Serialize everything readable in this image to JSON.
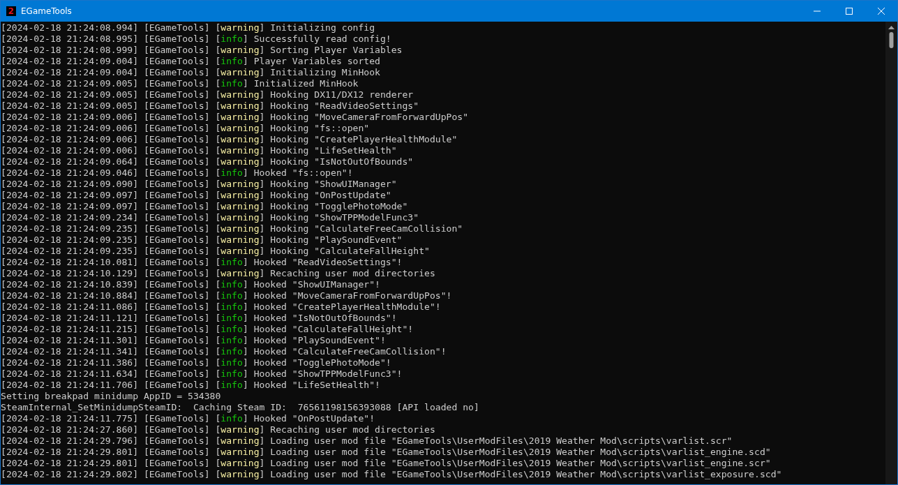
{
  "window": {
    "title": "EGameTools",
    "icon_text": "2"
  },
  "lines": [
    {
      "kind": "warning",
      "prefix": "[2024-02-18 21:24:08.994] [EGameTools] [",
      "level": "warning",
      "message": "] Initializing config"
    },
    {
      "kind": "info",
      "prefix": "[2024-02-18 21:24:08.995] [EGameTools] [",
      "level": "info",
      "message": "] Successfully read config!"
    },
    {
      "kind": "warning",
      "prefix": "[2024-02-18 21:24:08.999] [EGameTools] [",
      "level": "warning",
      "message": "] Sorting Player Variables"
    },
    {
      "kind": "info",
      "prefix": "[2024-02-18 21:24:09.004] [EGameTools] [",
      "level": "info",
      "message": "] Player Variables sorted"
    },
    {
      "kind": "warning",
      "prefix": "[2024-02-18 21:24:09.004] [EGameTools] [",
      "level": "warning",
      "message": "] Initializing MinHook"
    },
    {
      "kind": "info",
      "prefix": "[2024-02-18 21:24:09.005] [EGameTools] [",
      "level": "info",
      "message": "] Initialized MinHook"
    },
    {
      "kind": "warning",
      "prefix": "[2024-02-18 21:24:09.005] [EGameTools] [",
      "level": "warning",
      "message": "] Hooking DX11/DX12 renderer"
    },
    {
      "kind": "warning",
      "prefix": "[2024-02-18 21:24:09.005] [EGameTools] [",
      "level": "warning",
      "message": "] Hooking \"ReadVideoSettings\""
    },
    {
      "kind": "warning",
      "prefix": "[2024-02-18 21:24:09.006] [EGameTools] [",
      "level": "warning",
      "message": "] Hooking \"MoveCameraFromForwardUpPos\""
    },
    {
      "kind": "warning",
      "prefix": "[2024-02-18 21:24:09.006] [EGameTools] [",
      "level": "warning",
      "message": "] Hooking \"fs::open\""
    },
    {
      "kind": "warning",
      "prefix": "[2024-02-18 21:24:09.006] [EGameTools] [",
      "level": "warning",
      "message": "] Hooking \"CreatePlayerHealthModule\""
    },
    {
      "kind": "warning",
      "prefix": "[2024-02-18 21:24:09.006] [EGameTools] [",
      "level": "warning",
      "message": "] Hooking \"LifeSetHealth\""
    },
    {
      "kind": "warning",
      "prefix": "[2024-02-18 21:24:09.064] [EGameTools] [",
      "level": "warning",
      "message": "] Hooking \"IsNotOutOfBounds\""
    },
    {
      "kind": "info",
      "prefix": "[2024-02-18 21:24:09.046] [EGameTools] [",
      "level": "info",
      "message": "] Hooked \"fs::open\"!"
    },
    {
      "kind": "warning",
      "prefix": "[2024-02-18 21:24:09.090] [EGameTools] [",
      "level": "warning",
      "message": "] Hooking \"ShowUIManager\""
    },
    {
      "kind": "warning",
      "prefix": "[2024-02-18 21:24:09.097] [EGameTools] [",
      "level": "warning",
      "message": "] Hooking \"OnPostUpdate\""
    },
    {
      "kind": "warning",
      "prefix": "[2024-02-18 21:24:09.097] [EGameTools] [",
      "level": "warning",
      "message": "] Hooking \"TogglePhotoMode\""
    },
    {
      "kind": "warning",
      "prefix": "[2024-02-18 21:24:09.234] [EGameTools] [",
      "level": "warning",
      "message": "] Hooking \"ShowTPPModelFunc3\""
    },
    {
      "kind": "warning",
      "prefix": "[2024-02-18 21:24:09.235] [EGameTools] [",
      "level": "warning",
      "message": "] Hooking \"CalculateFreeCamCollision\""
    },
    {
      "kind": "warning",
      "prefix": "[2024-02-18 21:24:09.235] [EGameTools] [",
      "level": "warning",
      "message": "] Hooking \"PlaySoundEvent\""
    },
    {
      "kind": "warning",
      "prefix": "[2024-02-18 21:24:09.235] [EGameTools] [",
      "level": "warning",
      "message": "] Hooking \"CalculateFallHeight\""
    },
    {
      "kind": "info",
      "prefix": "[2024-02-18 21:24:10.081] [EGameTools] [",
      "level": "info",
      "message": "] Hooked \"ReadVideoSettings\"!"
    },
    {
      "kind": "warning",
      "prefix": "[2024-02-18 21:24:10.129] [EGameTools] [",
      "level": "warning",
      "message": "] Recaching user mod directories"
    },
    {
      "kind": "info",
      "prefix": "[2024-02-18 21:24:10.839] [EGameTools] [",
      "level": "info",
      "message": "] Hooked \"ShowUIManager\"!"
    },
    {
      "kind": "info",
      "prefix": "[2024-02-18 21:24:10.884] [EGameTools] [",
      "level": "info",
      "message": "] Hooked \"MoveCameraFromForwardUpPos\"!"
    },
    {
      "kind": "info",
      "prefix": "[2024-02-18 21:24:11.086] [EGameTools] [",
      "level": "info",
      "message": "] Hooked \"CreatePlayerHealthModule\"!"
    },
    {
      "kind": "info",
      "prefix": "[2024-02-18 21:24:11.121] [EGameTools] [",
      "level": "info",
      "message": "] Hooked \"IsNotOutOfBounds\"!"
    },
    {
      "kind": "info",
      "prefix": "[2024-02-18 21:24:11.215] [EGameTools] [",
      "level": "info",
      "message": "] Hooked \"CalculateFallHeight\"!"
    },
    {
      "kind": "info",
      "prefix": "[2024-02-18 21:24:11.301] [EGameTools] [",
      "level": "info",
      "message": "] Hooked \"PlaySoundEvent\"!"
    },
    {
      "kind": "info",
      "prefix": "[2024-02-18 21:24:11.341] [EGameTools] [",
      "level": "info",
      "message": "] Hooked \"CalculateFreeCamCollision\"!"
    },
    {
      "kind": "info",
      "prefix": "[2024-02-18 21:24:11.386] [EGameTools] [",
      "level": "info",
      "message": "] Hooked \"TogglePhotoMode\"!"
    },
    {
      "kind": "info",
      "prefix": "[2024-02-18 21:24:11.634] [EGameTools] [",
      "level": "info",
      "message": "] Hooked \"ShowTPPModelFunc3\"!"
    },
    {
      "kind": "info",
      "prefix": "[2024-02-18 21:24:11.706] [EGameTools] [",
      "level": "info",
      "message": "] Hooked \"LifeSetHealth\"!"
    },
    {
      "kind": "plain",
      "text": "Setting breakpad minidump AppID = 534380"
    },
    {
      "kind": "plain",
      "text": "SteamInternal_SetMinidumpSteamID:  Caching Steam ID:  76561198156393088 [API loaded no]"
    },
    {
      "kind": "info",
      "prefix": "[2024-02-18 21:24:11.775] [EGameTools] [",
      "level": "info",
      "message": "] Hooked \"OnPostUpdate\"!"
    },
    {
      "kind": "warning",
      "prefix": "[2024-02-18 21:24:27.860] [EGameTools] [",
      "level": "warning",
      "message": "] Recaching user mod directories"
    },
    {
      "kind": "warning",
      "prefix": "[2024-02-18 21:24:29.796] [EGameTools] [",
      "level": "warning",
      "message": "] Loading user mod file \"EGameTools\\UserModFiles\\2019 Weather Mod\\scripts\\varlist.scr\""
    },
    {
      "kind": "warning",
      "prefix": "[2024-02-18 21:24:29.801] [EGameTools] [",
      "level": "warning",
      "message": "] Loading user mod file \"EGameTools\\UserModFiles\\2019 Weather Mod\\scripts\\varlist_engine.scd\""
    },
    {
      "kind": "warning",
      "prefix": "[2024-02-18 21:24:29.801] [EGameTools] [",
      "level": "warning",
      "message": "] Loading user mod file \"EGameTools\\UserModFiles\\2019 Weather Mod\\scripts\\varlist_engine.scr\""
    },
    {
      "kind": "warning",
      "prefix": "[2024-02-18 21:24:29.802] [EGameTools] [",
      "level": "warning",
      "message": "] Loading user mod file \"EGameTools\\UserModFiles\\2019 Weather Mod\\scripts\\varlist_exposure.scd\""
    }
  ]
}
